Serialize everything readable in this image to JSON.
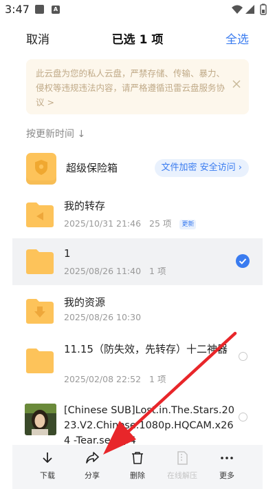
{
  "status_bar": {
    "time": "3:47",
    "notif_badge": "A"
  },
  "header": {
    "cancel": "取消",
    "title": "已选 1 项",
    "select_all": "全选"
  },
  "notice": {
    "text": "此云盘为您的私人云盘，严禁存储、传输、暴力、侵权等违规违法内容，请严格遵循迅雷云盘服务协议 >"
  },
  "sort": {
    "label": "按更新时间 ↓"
  },
  "vault": {
    "label": "超级保险箱",
    "action": "文件加密 安全访问 ›"
  },
  "files": [
    {
      "name": "我的转存",
      "date": "2025/10/31 21:46",
      "count": "25 项",
      "badge": "更新",
      "selected": false
    },
    {
      "name": "1",
      "date": "2025/08/26 11:40",
      "count": "1 项",
      "selected": true
    },
    {
      "name": "我的资源",
      "date": "2025/08/26 10:30",
      "count": "",
      "selected": false
    },
    {
      "name": "11.15（防失效，先转存）十二神器",
      "date": "2025/02/08 22:52",
      "count": "1 项",
      "selected": false
    },
    {
      "name": "[Chinese SUB]Lost.in.The.Stars.2023.V2.Chinese.1080p.HQCAM.x264 -Tear.se.mp4",
      "date": "",
      "count": "",
      "selected": false
    }
  ],
  "toolbar": {
    "download": "下载",
    "share": "分享",
    "delete": "删除",
    "online_unzip": "在线解压",
    "more": "更多"
  },
  "colors": {
    "accent": "#3a7cf0",
    "folder": "#fdc35a",
    "annotation_arrow": "#e8262a"
  }
}
